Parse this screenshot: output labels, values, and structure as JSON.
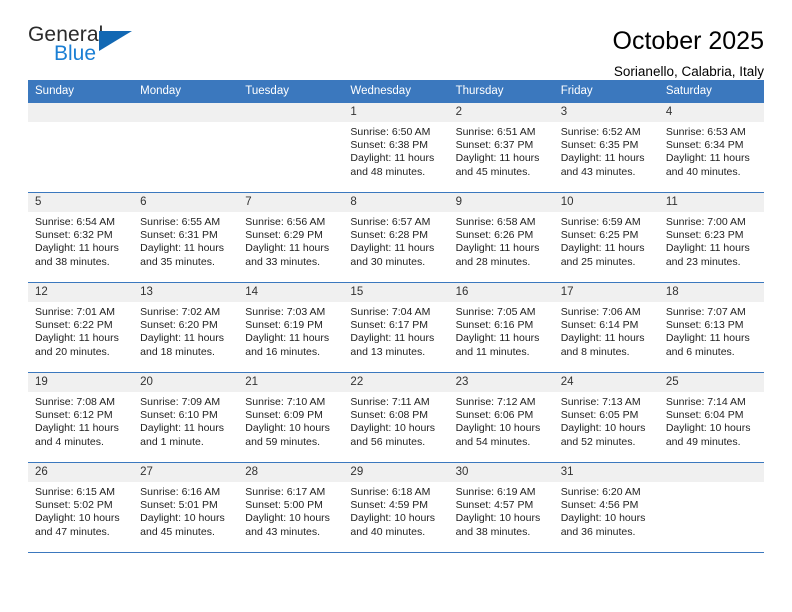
{
  "brand": {
    "line1": "General",
    "line2": "Blue",
    "triangle_color": "#1268b3",
    "blue_color": "#1b7fd4"
  },
  "header": {
    "title": "October 2025",
    "subtitle": "Sorianello, Calabria, Italy"
  },
  "theme": {
    "header_blue": "#3b78be",
    "daynum_bg": "#f0f0f0",
    "text": "#222222"
  },
  "weekday_headers": [
    "Sunday",
    "Monday",
    "Tuesday",
    "Wednesday",
    "Thursday",
    "Friday",
    "Saturday"
  ],
  "labels": {
    "sunrise_prefix": "Sunrise: ",
    "sunset_prefix": "Sunset: ",
    "daylight_prefix": "Daylight: "
  },
  "weeks": [
    [
      {
        "day": "",
        "sunrise": "",
        "sunset": "",
        "daylight": "",
        "empty": true
      },
      {
        "day": "",
        "sunrise": "",
        "sunset": "",
        "daylight": "",
        "empty": true
      },
      {
        "day": "",
        "sunrise": "",
        "sunset": "",
        "daylight": "",
        "empty": true
      },
      {
        "day": "1",
        "sunrise": "Sunrise: 6:50 AM",
        "sunset": "Sunset: 6:38 PM",
        "daylight": "Daylight: 11 hours and 48 minutes."
      },
      {
        "day": "2",
        "sunrise": "Sunrise: 6:51 AM",
        "sunset": "Sunset: 6:37 PM",
        "daylight": "Daylight: 11 hours and 45 minutes."
      },
      {
        "day": "3",
        "sunrise": "Sunrise: 6:52 AM",
        "sunset": "Sunset: 6:35 PM",
        "daylight": "Daylight: 11 hours and 43 minutes."
      },
      {
        "day": "4",
        "sunrise": "Sunrise: 6:53 AM",
        "sunset": "Sunset: 6:34 PM",
        "daylight": "Daylight: 11 hours and 40 minutes."
      }
    ],
    [
      {
        "day": "5",
        "sunrise": "Sunrise: 6:54 AM",
        "sunset": "Sunset: 6:32 PM",
        "daylight": "Daylight: 11 hours and 38 minutes."
      },
      {
        "day": "6",
        "sunrise": "Sunrise: 6:55 AM",
        "sunset": "Sunset: 6:31 PM",
        "daylight": "Daylight: 11 hours and 35 minutes."
      },
      {
        "day": "7",
        "sunrise": "Sunrise: 6:56 AM",
        "sunset": "Sunset: 6:29 PM",
        "daylight": "Daylight: 11 hours and 33 minutes."
      },
      {
        "day": "8",
        "sunrise": "Sunrise: 6:57 AM",
        "sunset": "Sunset: 6:28 PM",
        "daylight": "Daylight: 11 hours and 30 minutes."
      },
      {
        "day": "9",
        "sunrise": "Sunrise: 6:58 AM",
        "sunset": "Sunset: 6:26 PM",
        "daylight": "Daylight: 11 hours and 28 minutes."
      },
      {
        "day": "10",
        "sunrise": "Sunrise: 6:59 AM",
        "sunset": "Sunset: 6:25 PM",
        "daylight": "Daylight: 11 hours and 25 minutes."
      },
      {
        "day": "11",
        "sunrise": "Sunrise: 7:00 AM",
        "sunset": "Sunset: 6:23 PM",
        "daylight": "Daylight: 11 hours and 23 minutes."
      }
    ],
    [
      {
        "day": "12",
        "sunrise": "Sunrise: 7:01 AM",
        "sunset": "Sunset: 6:22 PM",
        "daylight": "Daylight: 11 hours and 20 minutes."
      },
      {
        "day": "13",
        "sunrise": "Sunrise: 7:02 AM",
        "sunset": "Sunset: 6:20 PM",
        "daylight": "Daylight: 11 hours and 18 minutes."
      },
      {
        "day": "14",
        "sunrise": "Sunrise: 7:03 AM",
        "sunset": "Sunset: 6:19 PM",
        "daylight": "Daylight: 11 hours and 16 minutes."
      },
      {
        "day": "15",
        "sunrise": "Sunrise: 7:04 AM",
        "sunset": "Sunset: 6:17 PM",
        "daylight": "Daylight: 11 hours and 13 minutes."
      },
      {
        "day": "16",
        "sunrise": "Sunrise: 7:05 AM",
        "sunset": "Sunset: 6:16 PM",
        "daylight": "Daylight: 11 hours and 11 minutes."
      },
      {
        "day": "17",
        "sunrise": "Sunrise: 7:06 AM",
        "sunset": "Sunset: 6:14 PM",
        "daylight": "Daylight: 11 hours and 8 minutes."
      },
      {
        "day": "18",
        "sunrise": "Sunrise: 7:07 AM",
        "sunset": "Sunset: 6:13 PM",
        "daylight": "Daylight: 11 hours and 6 minutes."
      }
    ],
    [
      {
        "day": "19",
        "sunrise": "Sunrise: 7:08 AM",
        "sunset": "Sunset: 6:12 PM",
        "daylight": "Daylight: 11 hours and 4 minutes."
      },
      {
        "day": "20",
        "sunrise": "Sunrise: 7:09 AM",
        "sunset": "Sunset: 6:10 PM",
        "daylight": "Daylight: 11 hours and 1 minute."
      },
      {
        "day": "21",
        "sunrise": "Sunrise: 7:10 AM",
        "sunset": "Sunset: 6:09 PM",
        "daylight": "Daylight: 10 hours and 59 minutes."
      },
      {
        "day": "22",
        "sunrise": "Sunrise: 7:11 AM",
        "sunset": "Sunset: 6:08 PM",
        "daylight": "Daylight: 10 hours and 56 minutes."
      },
      {
        "day": "23",
        "sunrise": "Sunrise: 7:12 AM",
        "sunset": "Sunset: 6:06 PM",
        "daylight": "Daylight: 10 hours and 54 minutes."
      },
      {
        "day": "24",
        "sunrise": "Sunrise: 7:13 AM",
        "sunset": "Sunset: 6:05 PM",
        "daylight": "Daylight: 10 hours and 52 minutes."
      },
      {
        "day": "25",
        "sunrise": "Sunrise: 7:14 AM",
        "sunset": "Sunset: 6:04 PM",
        "daylight": "Daylight: 10 hours and 49 minutes."
      }
    ],
    [
      {
        "day": "26",
        "sunrise": "Sunrise: 6:15 AM",
        "sunset": "Sunset: 5:02 PM",
        "daylight": "Daylight: 10 hours and 47 minutes."
      },
      {
        "day": "27",
        "sunrise": "Sunrise: 6:16 AM",
        "sunset": "Sunset: 5:01 PM",
        "daylight": "Daylight: 10 hours and 45 minutes."
      },
      {
        "day": "28",
        "sunrise": "Sunrise: 6:17 AM",
        "sunset": "Sunset: 5:00 PM",
        "daylight": "Daylight: 10 hours and 43 minutes."
      },
      {
        "day": "29",
        "sunrise": "Sunrise: 6:18 AM",
        "sunset": "Sunset: 4:59 PM",
        "daylight": "Daylight: 10 hours and 40 minutes."
      },
      {
        "day": "30",
        "sunrise": "Sunrise: 6:19 AM",
        "sunset": "Sunset: 4:57 PM",
        "daylight": "Daylight: 10 hours and 38 minutes."
      },
      {
        "day": "31",
        "sunrise": "Sunrise: 6:20 AM",
        "sunset": "Sunset: 4:56 PM",
        "daylight": "Daylight: 10 hours and 36 minutes."
      },
      {
        "day": "",
        "sunrise": "",
        "sunset": "",
        "daylight": "",
        "empty": true
      }
    ]
  ]
}
